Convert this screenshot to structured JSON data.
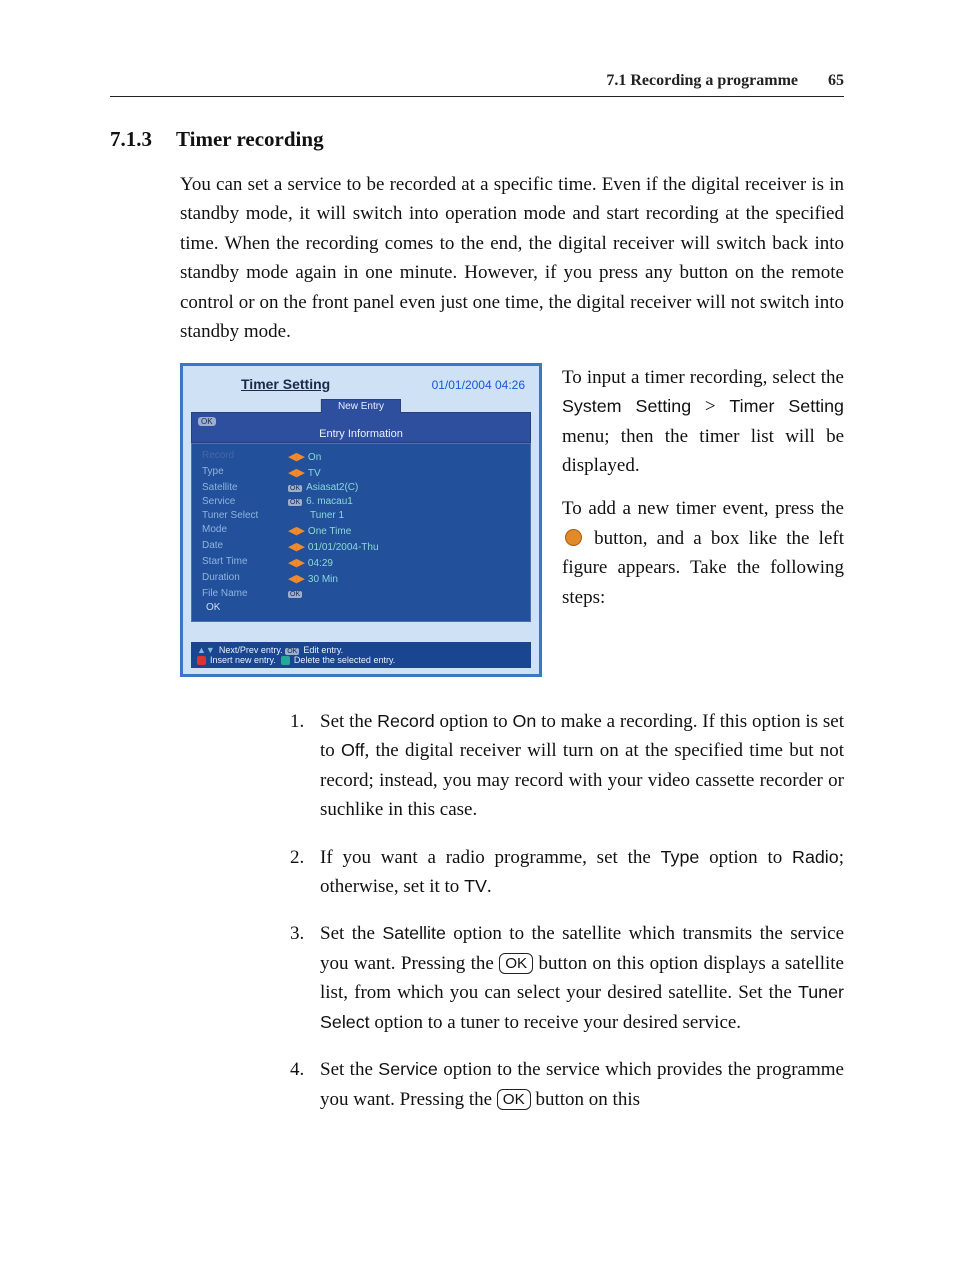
{
  "header": {
    "running": "7.1 Recording a programme",
    "page_number": "65"
  },
  "section": {
    "number": "7.1.3",
    "title": "Timer recording"
  },
  "intro_para": "You can set a service to be recorded at a specific time. Even if the digital receiver is in standby mode, it will switch into operation mode and start recording at the specified time. When the recording comes to the end, the digital receiver will switch back into standby mode again in one minute.  However, if you press any button on the remote control or on the front panel even just one time, the digital receiver will not switch into standby mode.",
  "figure": {
    "header_title": "Timer Setting",
    "header_date": "01/01/2004 04:26",
    "tab_label": "New Entry",
    "info_title": "Entry Information",
    "fields": {
      "record": {
        "label": "Record",
        "value": "On"
      },
      "type": {
        "label": "Type",
        "value": "TV"
      },
      "satellite": {
        "label": "Satellite",
        "value": "Asiasat2(C)"
      },
      "service": {
        "label": "Service",
        "value": "6. macau1"
      },
      "tuner_select": {
        "label": "Tuner Select",
        "value": "Tuner 1"
      },
      "mode": {
        "label": "Mode",
        "value": "One Time"
      },
      "date": {
        "label": "Date",
        "value": "01/01/2004-Thu"
      },
      "start_time": {
        "label": "Start Time",
        "value": "04:29"
      },
      "duration": {
        "label": "Duration",
        "value": "30 Min"
      },
      "file_name": {
        "label": "File Name",
        "value": "OK"
      },
      "ok_row": "OK"
    },
    "hints": {
      "line1a": "Next/Prev entry.",
      "line1b": "Edit entry.",
      "line2a": "Insert new entry.",
      "line2b": "Delete the selected entry."
    }
  },
  "side": {
    "p1_a": "To input a timer recording, select the ",
    "p1_menu1": "System Setting",
    "p1_gt": " > ",
    "p1_menu2": "Timer Setting",
    "p1_b": " menu; then the timer list will be displayed.",
    "p2_a": "To add a new timer event, press the ",
    "p2_b": " button, and a box like the left figure appears. Take the following steps:"
  },
  "steps": [
    {
      "num": "1.",
      "parts": [
        {
          "t": "Set the "
        },
        {
          "u": "Record"
        },
        {
          "t": " option to "
        },
        {
          "u": "On"
        },
        {
          "t": " to make a recording. If this option is set to "
        },
        {
          "u": "Off"
        },
        {
          "t": ", the digital receiver will turn on at the specified time but not record; instead, you may record with your video cassette recorder or suchlike in this case."
        }
      ]
    },
    {
      "num": "2.",
      "parts": [
        {
          "t": "If you want a radio programme, set the "
        },
        {
          "u": "Type"
        },
        {
          "t": " option to "
        },
        {
          "u": "Radio"
        },
        {
          "t": "; otherwise, set it to "
        },
        {
          "u": "TV"
        },
        {
          "t": "."
        }
      ]
    },
    {
      "num": "3.",
      "parts": [
        {
          "t": "Set the "
        },
        {
          "u": "Satellite"
        },
        {
          "t": " option to the satellite which transmits the service you want. Pressing the "
        },
        {
          "ok": true
        },
        {
          "t": " button on this option displays a satellite list, from which you can select your desired satellite. Set the "
        },
        {
          "u": "Tuner Select"
        },
        {
          "t": " option to a tuner to receive your desired service."
        }
      ]
    },
    {
      "num": "4.",
      "parts": [
        {
          "t": "Set the "
        },
        {
          "u": "Service"
        },
        {
          "t": " option to the service which provides the programme you want. Pressing the "
        },
        {
          "ok": true
        },
        {
          "t": " button on this"
        }
      ]
    }
  ],
  "tokens": {
    "ok_label": "OK"
  }
}
